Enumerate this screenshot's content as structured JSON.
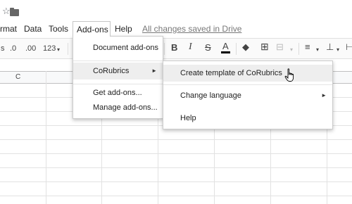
{
  "menubar": {
    "items": [
      "rmat",
      "Data",
      "Tools",
      "Add-ons",
      "Help"
    ],
    "status": "All changes saved in Drive"
  },
  "toolbar": {
    "dec_left": "s",
    "dec_less": ".0",
    "dec_more": ".00",
    "format": "123",
    "bold": "B",
    "italic": "I",
    "strike": "S",
    "textcolor": "A"
  },
  "grid": {
    "col_c": "C"
  },
  "addons_menu": {
    "items": [
      "Document add-ons",
      "CoRubrics",
      "Get add-ons...",
      "Manage add-ons..."
    ]
  },
  "corubrics_menu": {
    "items": [
      "Create template of CoRubrics",
      "Change language",
      "Help"
    ]
  },
  "colors": {
    "accent": "#000000",
    "highlight": "#eeeeee",
    "menu_border": "#cccccc"
  }
}
